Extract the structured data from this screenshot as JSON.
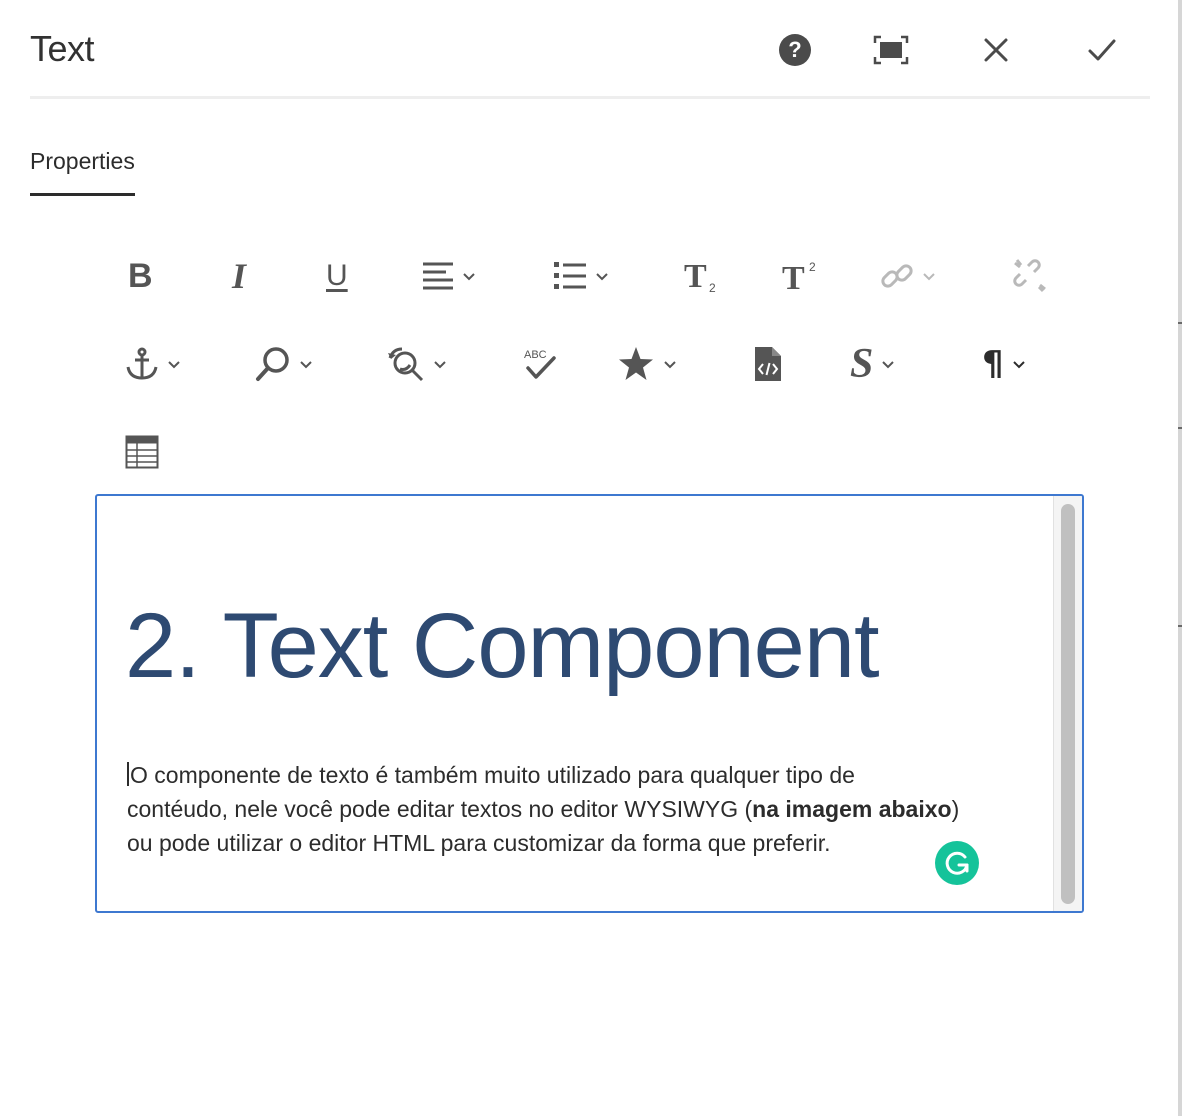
{
  "dialog": {
    "title": "Text",
    "buttons": {
      "help": "help-icon",
      "fullscreen": "fullscreen-icon",
      "close": "close-icon",
      "done": "checkmark-icon"
    }
  },
  "tabs": [
    {
      "label": "Properties",
      "selected": true
    }
  ],
  "toolbar": {
    "rows": [
      [
        "bold",
        "italic",
        "underline",
        "justify",
        "lists",
        "subscript",
        "superscript",
        "link",
        "unlink"
      ],
      [
        "anchor",
        "find",
        "find-replace",
        "spellcheck",
        "special-characters",
        "source-edit",
        "styles",
        "paragraph-format"
      ],
      [
        "table"
      ]
    ],
    "bold_glyph": "B",
    "italic_glyph": "I",
    "underline_glyph": "U",
    "styles_glyph": "S",
    "paragraph_glyph": "¶",
    "spellcheck_glyph": "ABC"
  },
  "editor": {
    "heading": "2. Text Component",
    "paragraph": {
      "line1": "O componente de texto é também muito utilizado para qualquer tipo de",
      "line2a": "contéudo, nele você pode editar textos no editor WYSIWYG (",
      "line2_bold": "na imagem abaixo",
      "line2b": ")",
      "line3": "ou pode utilizar o editor HTML para customizar da forma que preferir."
    },
    "grammarly_icon": "grammarly-icon"
  },
  "colors": {
    "heading": "#2e4a72",
    "editor_border": "#3e78d0",
    "grammarly": "#15c39a",
    "icon": "#555555",
    "icon_disabled": "#b9b9b9"
  }
}
